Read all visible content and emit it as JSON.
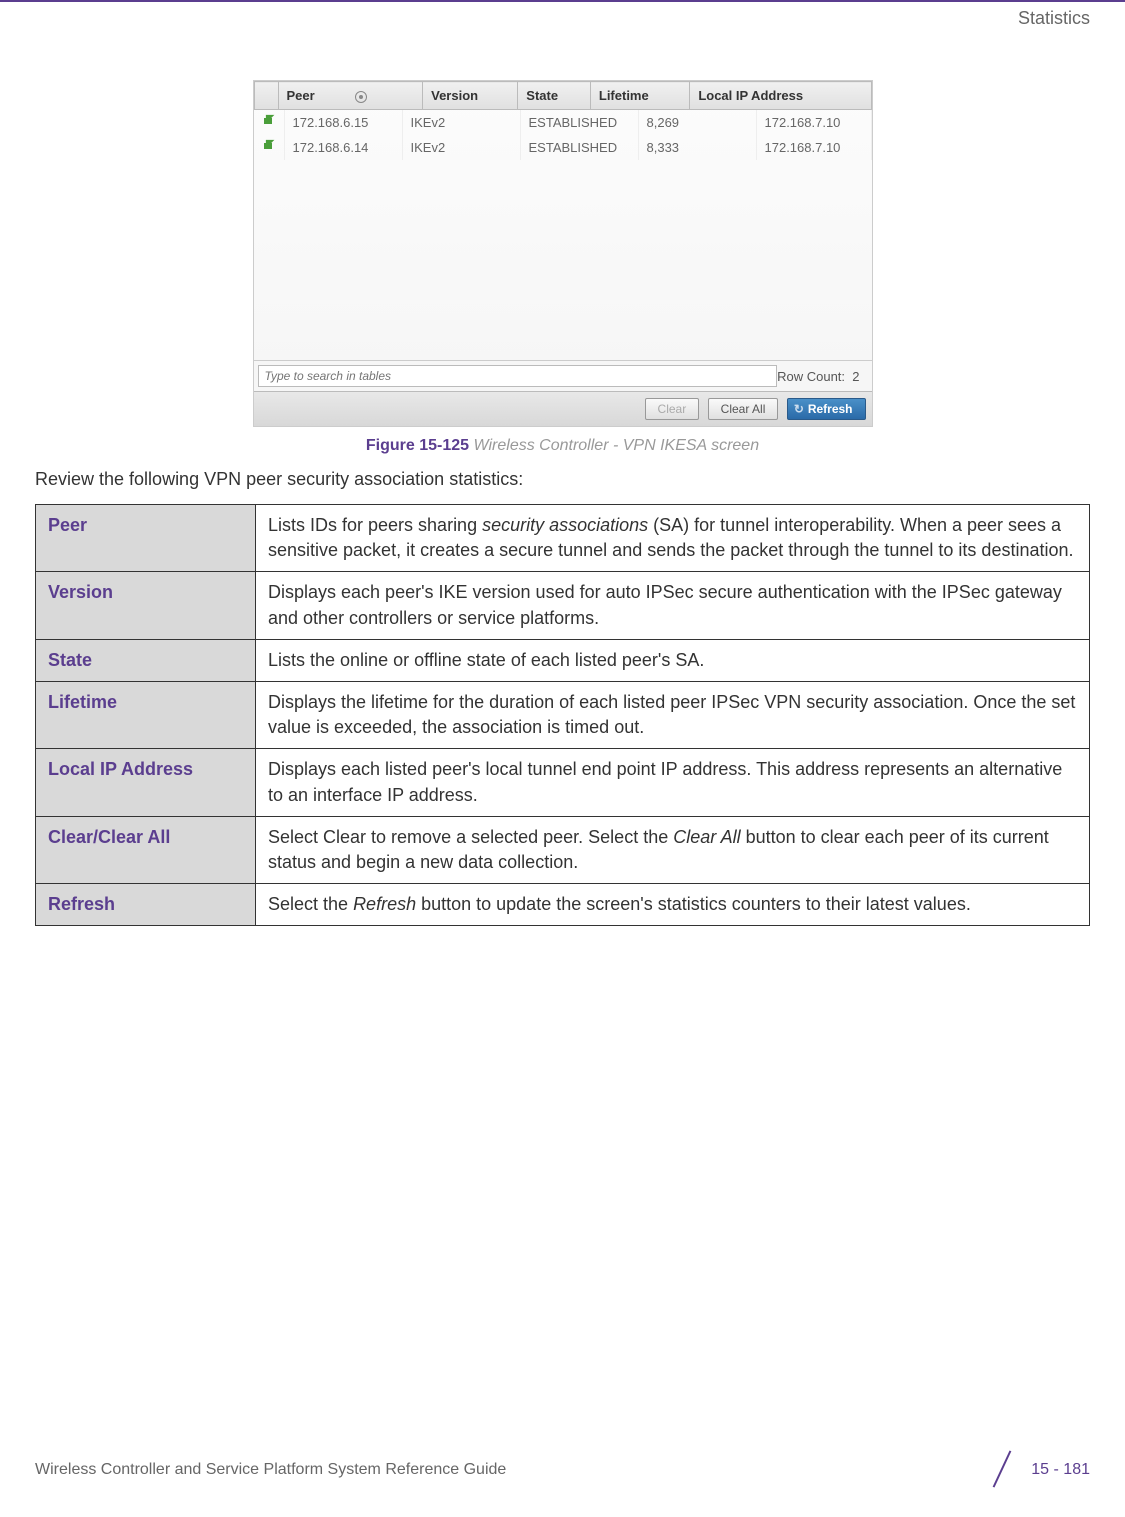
{
  "header": {
    "section": "Statistics"
  },
  "screenshot": {
    "columns": [
      "Peer",
      "Version",
      "State",
      "Lifetime",
      "Local IP Address"
    ],
    "rows": [
      {
        "peer": "172.168.6.15",
        "version": "IKEv2",
        "state": "ESTABLISHED",
        "lifetime": "8,269",
        "localip": "172.168.7.10"
      },
      {
        "peer": "172.168.6.14",
        "version": "IKEv2",
        "state": "ESTABLISHED",
        "lifetime": "8,333",
        "localip": "172.168.7.10"
      }
    ],
    "search_placeholder": "Type to search in tables",
    "row_count_label": "Row Count:",
    "row_count_value": "2",
    "buttons": {
      "clear": "Clear",
      "clear_all": "Clear All",
      "refresh": "Refresh"
    }
  },
  "figure": {
    "number": "Figure 15-125",
    "title": "Wireless Controller - VPN IKESA screen"
  },
  "intro": "Review the following VPN peer security association statistics:",
  "descriptions": [
    {
      "term": "Peer",
      "text_pre": "Lists IDs for peers sharing ",
      "text_em": "security associations",
      "text_post": " (SA) for tunnel interoperability. When a peer sees a sensitive packet, it creates a secure tunnel and sends the packet through the tunnel to its destination."
    },
    {
      "term": "Version",
      "text": "Displays each peer's IKE version used for auto IPSec secure authentication with the IPSec gateway and other controllers or service platforms."
    },
    {
      "term": "State",
      "text": "Lists the online or offline state of each listed peer's SA."
    },
    {
      "term": "Lifetime",
      "text": "Displays the lifetime for the duration of each listed peer IPSec VPN security association. Once the set value is exceeded, the association is timed out."
    },
    {
      "term": "Local IP Address",
      "text": "Displays each listed peer's local tunnel end point IP address. This address represents an alternative to an interface IP address."
    },
    {
      "term": "Clear/Clear All",
      "text_pre": "Select Clear to remove a selected peer. Select the ",
      "text_em": "Clear All",
      "text_post": " button to clear each peer of its current status and begin a new data collection."
    },
    {
      "term": "Refresh",
      "text_pre": "Select the ",
      "text_em": "Refresh",
      "text_post": " button to update the screen's statistics counters to their latest values."
    }
  ],
  "footer": {
    "guide": "Wireless Controller and Service Platform System Reference Guide",
    "page": "15 - 181"
  }
}
